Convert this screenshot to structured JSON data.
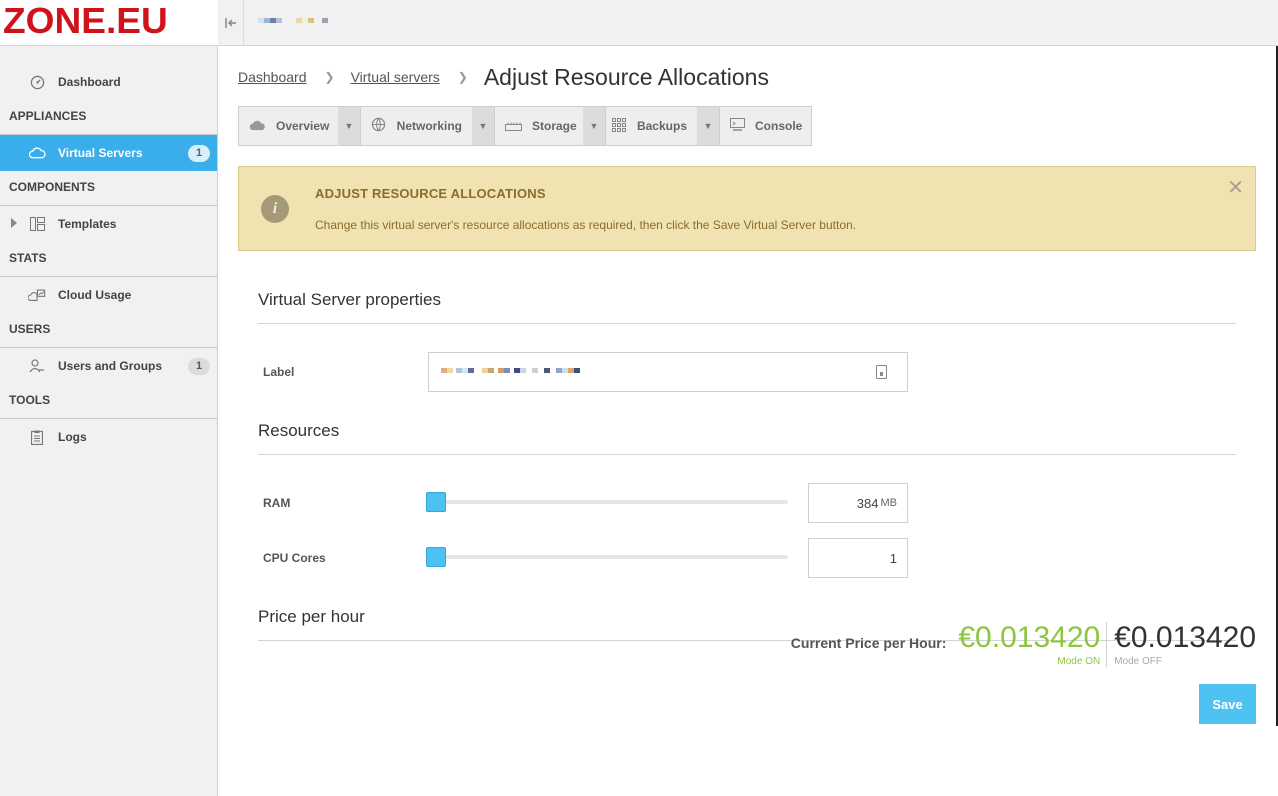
{
  "logo": "ZONE.EU",
  "sidebar": {
    "dashboard": "Dashboard",
    "sections": {
      "appliances": "APPLIANCES",
      "components": "COMPONENTS",
      "stats": "STATS",
      "users": "USERS",
      "tools": "TOOLS"
    },
    "virtual_servers": {
      "label": "Virtual Servers",
      "count": "1"
    },
    "templates": "Templates",
    "cloud_usage": "Cloud Usage",
    "users_groups": {
      "label": "Users and Groups",
      "count": "1"
    },
    "logs": "Logs"
  },
  "breadcrumb": {
    "home": "Dashboard",
    "parent": "Virtual servers",
    "current": "Adjust Resource Allocations"
  },
  "tabs": [
    {
      "label": "Overview",
      "icon": "cloud-icon"
    },
    {
      "label": "Networking",
      "icon": "globe-icon"
    },
    {
      "label": "Storage",
      "icon": "disk-icon"
    },
    {
      "label": "Backups",
      "icon": "grid-icon"
    },
    {
      "label": "Console",
      "icon": "monitor-icon"
    }
  ],
  "alert": {
    "title": "ADJUST RESOURCE ALLOCATIONS",
    "text": "Change this virtual server's resource allocations as required, then click the Save Virtual Server button."
  },
  "properties": {
    "heading": "Virtual Server properties",
    "label_field": "Label"
  },
  "resources": {
    "heading": "Resources",
    "ram": {
      "label": "RAM",
      "value": "384",
      "unit": "MB",
      "slider_fraction": 0.0
    },
    "cpu": {
      "label": "CPU Cores",
      "value": "1",
      "slider_fraction": 0.0
    }
  },
  "price": {
    "heading": "Price per hour",
    "label": "Current Price per Hour:",
    "on_value": "€0.013420",
    "on_mode": "Mode ON",
    "off_value": "€0.013420",
    "off_mode": "Mode OFF"
  },
  "save_label": "Save",
  "colors": {
    "accent": "#3aaeea",
    "price_on": "#8cc63f",
    "alert_bg": "#f0e3b1",
    "brand": "#d0121b"
  }
}
